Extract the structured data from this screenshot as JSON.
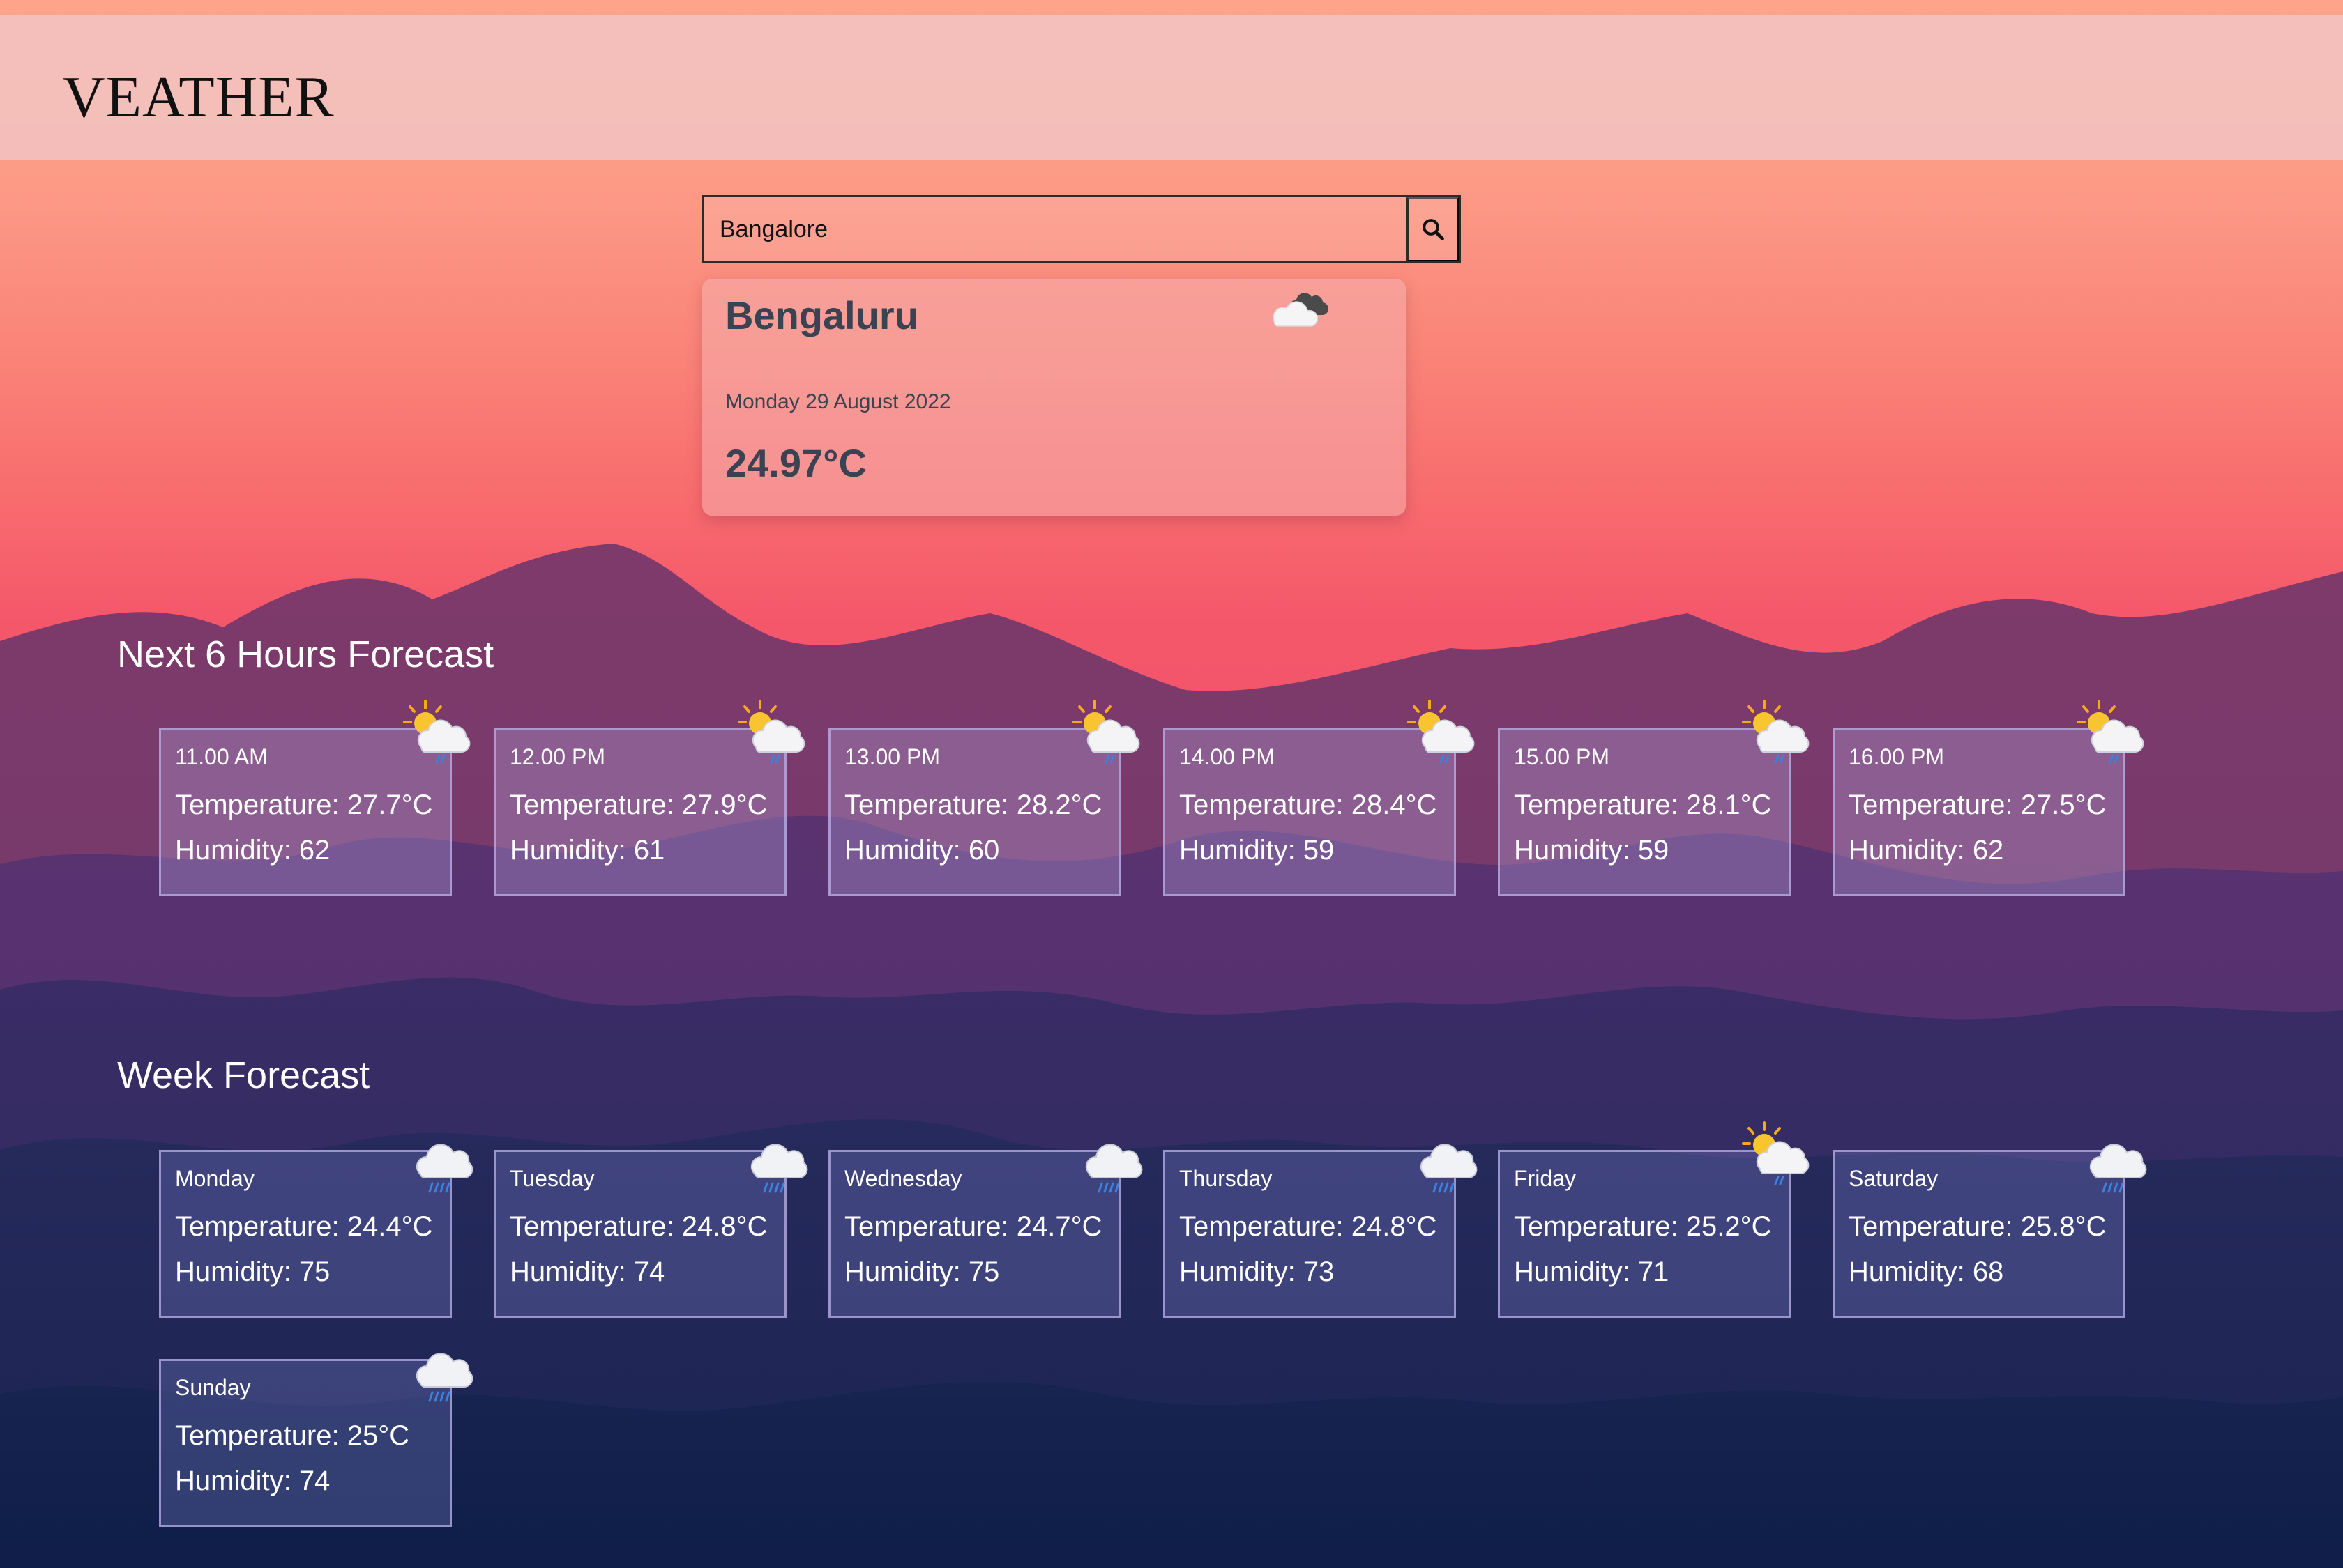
{
  "app": {
    "title": "VEATHER"
  },
  "colors": {
    "header_bg": "#f2c4c4",
    "text_dark": "#3b4252",
    "text_light": "#ffffff"
  },
  "search": {
    "value": "Bangalore",
    "placeholder": "",
    "button_icon": "search-icon"
  },
  "current": {
    "city": "Bengaluru",
    "date": "Monday 29 August 2022",
    "temperature": "24.97°C",
    "icon": "cloud-icon"
  },
  "hourly": {
    "title": "Next 6 Hours Forecast",
    "items": [
      {
        "label": "11.00 AM",
        "temperature": "Temperature: 27.7°C",
        "humidity": "Humidity: 62",
        "icon": "sun-cloud-rain-icon"
      },
      {
        "label": "12.00 PM",
        "temperature": "Temperature: 27.9°C",
        "humidity": "Humidity: 61",
        "icon": "sun-cloud-rain-icon"
      },
      {
        "label": "13.00 PM",
        "temperature": "Temperature: 28.2°C",
        "humidity": "Humidity: 60",
        "icon": "sun-cloud-rain-icon"
      },
      {
        "label": "14.00 PM",
        "temperature": "Temperature: 28.4°C",
        "humidity": "Humidity: 59",
        "icon": "sun-cloud-rain-icon"
      },
      {
        "label": "15.00 PM",
        "temperature": "Temperature: 28.1°C",
        "humidity": "Humidity: 59",
        "icon": "sun-cloud-rain-icon"
      },
      {
        "label": "16.00 PM",
        "temperature": "Temperature: 27.5°C",
        "humidity": "Humidity: 62",
        "icon": "sun-cloud-rain-icon"
      }
    ]
  },
  "weekly": {
    "title": "Week Forecast",
    "items": [
      {
        "label": "Monday",
        "temperature": "Temperature: 24.4°C",
        "humidity": "Humidity: 75",
        "icon": "rain-cloud-icon"
      },
      {
        "label": "Tuesday",
        "temperature": "Temperature: 24.8°C",
        "humidity": "Humidity: 74",
        "icon": "rain-cloud-icon"
      },
      {
        "label": "Wednesday",
        "temperature": "Temperature: 24.7°C",
        "humidity": "Humidity: 75",
        "icon": "rain-cloud-icon"
      },
      {
        "label": "Thursday",
        "temperature": "Temperature: 24.8°C",
        "humidity": "Humidity: 73",
        "icon": "rain-cloud-icon"
      },
      {
        "label": "Friday",
        "temperature": "Temperature: 25.2°C",
        "humidity": "Humidity: 71",
        "icon": "sun-cloud-rain-icon"
      },
      {
        "label": "Saturday",
        "temperature": "Temperature: 25.8°C",
        "humidity": "Humidity: 68",
        "icon": "rain-cloud-icon"
      },
      {
        "label": "Sunday",
        "temperature": "Temperature: 25°C",
        "humidity": "Humidity: 74",
        "icon": "rain-cloud-icon"
      }
    ]
  }
}
